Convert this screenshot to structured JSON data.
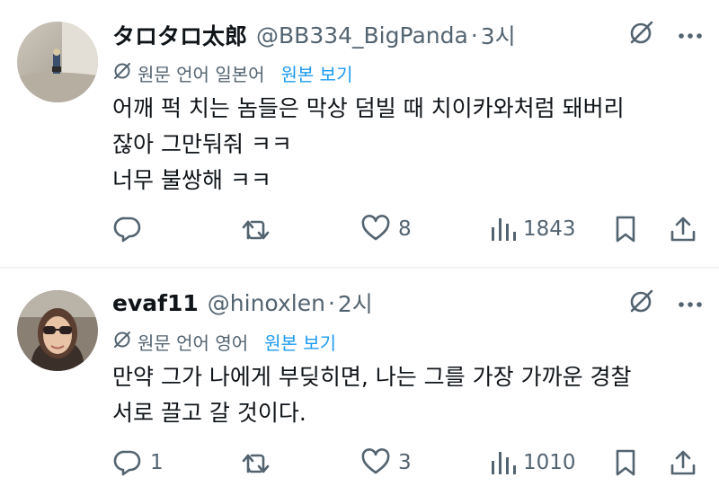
{
  "tweets": [
    {
      "author_name": "タロタロ太郎",
      "handle": "@BB334_BigPanda",
      "separator": "·",
      "time": "3시",
      "translate_label": "원문 언어 일본어",
      "translate_link": "원본 보기",
      "lines": [
        "어깨 퍽 치는 놈들은 막상 덤빌 때 치이카와처럼 돼버리",
        "잖아 그만둬줘 ㅋㅋ",
        "너무 불쌍해 ㅋㅋ"
      ],
      "reply_count": "",
      "retweet_count": "",
      "like_count": "8",
      "view_count": "1843"
    },
    {
      "author_name": "evaf11",
      "handle": "@hinoxlen",
      "separator": "·",
      "time": "2시",
      "translate_label": "원문 언어 영어",
      "translate_link": "원본 보기",
      "lines": [
        "만약 그가 나에게 부딪히면, 나는 그를 가장 가까운 경찰",
        "서로 끌고 갈 것이다."
      ],
      "reply_count": "1",
      "retweet_count": "",
      "like_count": "3",
      "view_count": "1010"
    }
  ],
  "icons": {
    "grok": "grok-icon",
    "more": "more-icon",
    "translate": "translate-icon",
    "reply": "reply-icon",
    "retweet": "retweet-icon",
    "like": "heart-icon",
    "views": "views-icon",
    "bookmark": "bookmark-icon",
    "share": "share-icon"
  },
  "colors": {
    "text": "#0f1419",
    "secondary": "#536471",
    "link": "#1d9bf0",
    "divider": "#eff3f4"
  }
}
